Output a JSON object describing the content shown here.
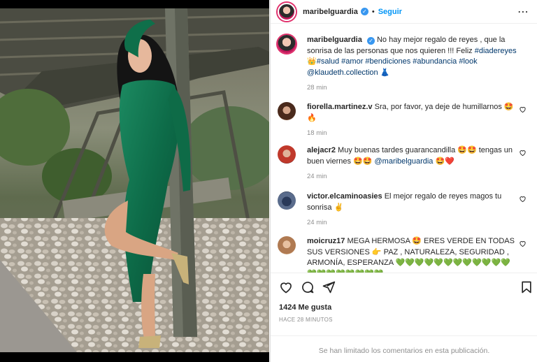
{
  "photo": {
    "alt": ""
  },
  "post": {
    "username": "maribelguardia",
    "follow_label": "Seguir",
    "dot": "•",
    "more_icon": "more-options-icon"
  },
  "caption": {
    "username": "maribelguardia",
    "text": "No hay mejor regalo de reyes , que la sonrisa de las personas que nos quieren !!! Feliz ",
    "tag1": "#diadereyes",
    "text2": " ",
    "tags_line": "#salud #amor #bendiciones #abundancia #look",
    "mention": "@klaudeth.collection",
    "time": "28 min"
  },
  "comments": [
    {
      "username": "fiorella.martinez.v",
      "text": "Sra, por favor, ya deje de humillarnos 🤩",
      "extra": "🔥",
      "time": "18 min"
    },
    {
      "username": "alejacr2",
      "text": "Muy buenas tardes guarancandilla 🤩🤩 tengas un buen viernes 🤩🤩 ",
      "mention": "@maribelguardia",
      "tail": " 🤩❤️",
      "time": "24 min"
    },
    {
      "username": "victor.elcaminoasies",
      "text": "El mejor regalo de reyes magos tu sonrisa ✌️",
      "time": "24 min"
    },
    {
      "username": "moicruz17",
      "text": "MEGA HERMOSA 🤩 ERES VERDE EN TODAS SUS VERSIONES 👉 PAZ , NATURALEZA, SEGURIDAD , ARMONÍA, ESPERANZA 💚💚💚💚💚💚💚💚💚💚💚💚💚💚💚💚💚💚💚💚"
    }
  ],
  "actions": {
    "likes": "1424 Me gusta",
    "ago": "HACE 28 MINUTOS"
  },
  "limited_comments": "Se han limitado los comentarios en esta publicación.",
  "colors": {
    "link": "#00376b",
    "follow": "#0095f6",
    "verified": "#3897f0",
    "muted": "#8e8e8e"
  }
}
